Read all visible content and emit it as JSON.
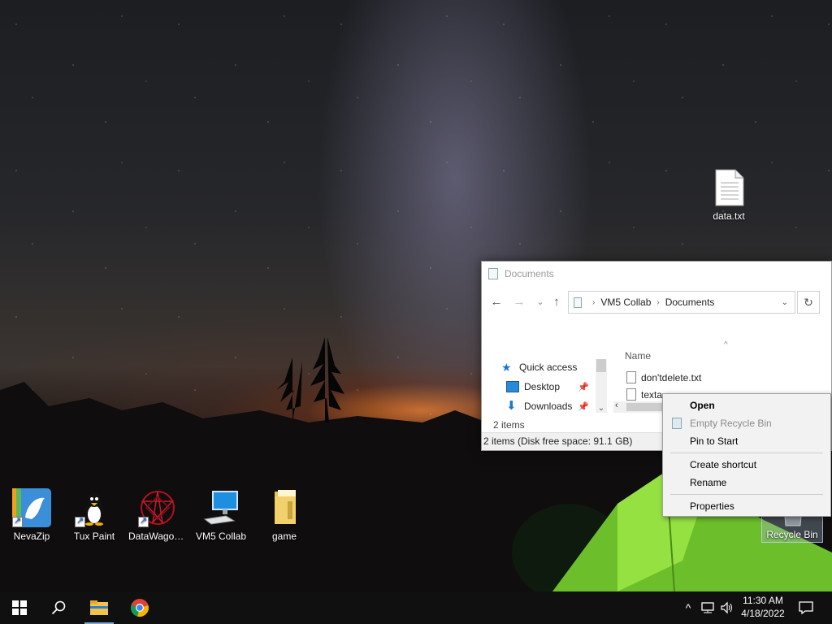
{
  "desktop": {
    "icons": [
      {
        "label": "NevaZip",
        "icon": "nevazip-bird-icon"
      },
      {
        "label": "Tux Paint",
        "icon": "tux-penguin-icon"
      },
      {
        "label": "DataWagon...",
        "icon": "datawagon-star-icon"
      },
      {
        "label": "VM5 Collab",
        "icon": "computer-icon"
      },
      {
        "label": "game",
        "icon": "folder-icon"
      }
    ],
    "data_file": {
      "label": "data.txt",
      "icon": "text-file-icon"
    },
    "recycle_bin": {
      "label": "Recycle Bin",
      "icon": "recycle-bin-icon"
    }
  },
  "explorer": {
    "title": "Documents",
    "breadcrumb": [
      "VM5 Collab",
      "Documents"
    ],
    "nav": {
      "back": "←",
      "forward": "→",
      "recent": "⌄",
      "up": "↑",
      "refresh": "↻"
    },
    "nav_pane": [
      {
        "label": "Quick access",
        "icon": "star-icon"
      },
      {
        "label": "Desktop",
        "icon": "desktop-icon",
        "pinned": true
      },
      {
        "label": "Downloads",
        "icon": "download-icon",
        "pinned": true
      }
    ],
    "column_header": "Name",
    "files": [
      {
        "name": "don'tdelete.txt",
        "icon": "text-file-icon"
      },
      {
        "name": "texta",
        "icon": "text-file-icon"
      }
    ],
    "item_count": "2 items",
    "status": "2 items (Disk free space: 91.1 GB)"
  },
  "context_menu": {
    "items": [
      {
        "label": "Open",
        "bold": true
      },
      {
        "label": "Empty Recycle Bin",
        "disabled": true,
        "icon": "recycle-bin-icon"
      },
      {
        "label": "Pin to Start"
      },
      {
        "label": "Create shortcut"
      },
      {
        "label": "Rename"
      },
      {
        "label": "Properties"
      }
    ]
  },
  "taskbar": {
    "pinned": [
      "start-icon",
      "search-icon",
      "file-explorer-icon",
      "chrome-icon"
    ],
    "tray_icons": [
      "chevron-up-icon",
      "network-icon",
      "volume-icon"
    ],
    "time": "11:30 AM",
    "date": "4/18/2022",
    "notifications_icon": "action-center-icon"
  },
  "colors": {
    "taskbar_bg": "#101010",
    "active_app_underline": "#7aa7d8",
    "menu_bg": "#f2f2f2",
    "tent_green": "#8ed63a"
  }
}
